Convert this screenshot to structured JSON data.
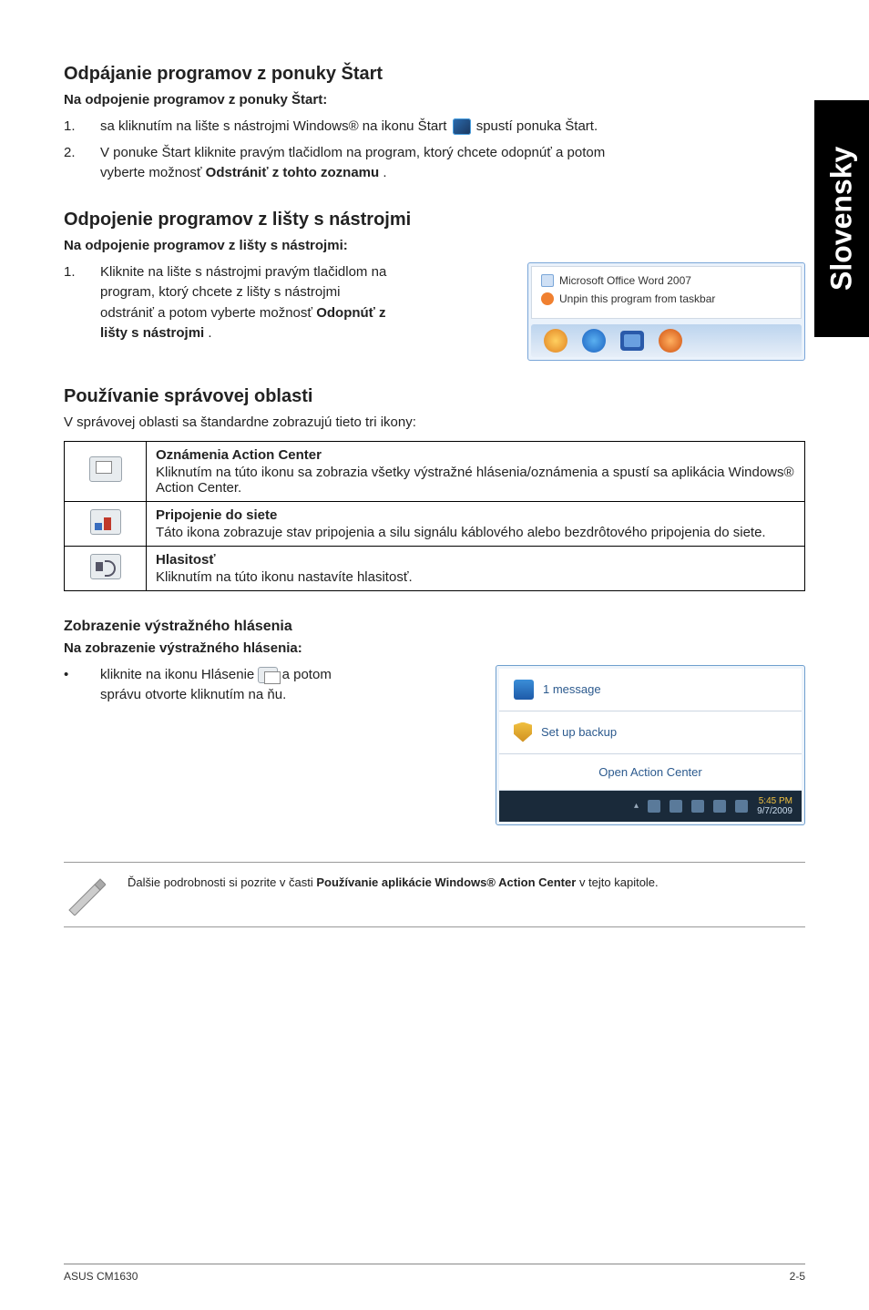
{
  "side_tab": "Slovensky",
  "sec1": {
    "title": "Odpájanie programov z ponuky Štart",
    "sub": "Na odpojenie programov z ponuky Štart:",
    "step1_a": "sa kliknutím na lište s nástrojmi Windows® na ikonu Štart ",
    "step1_b": " spustí ponuka Štart.",
    "step2": "V ponuke Štart kliknite pravým tlačidlom na program, ktorý chcete odopnúť a potom vyberte možnosť ",
    "step2_bold": "Odstrániť z tohto zoznamu",
    "step2_end": "."
  },
  "sec2": {
    "title": "Odpojenie programov z lišty s nástrojmi",
    "sub": "Na odpojenie programov z lišty s nástrojmi:",
    "step1": "Kliknite na lište s nástrojmi pravým tlačidlom na program, ktorý chcete z lišty s nástrojmi odstrániť a potom vyberte možnosť ",
    "step1_bold": "Odopnúť z lišty s nástrojmi",
    "step1_end": ".",
    "win": {
      "row1": "Microsoft Office Word 2007",
      "row2": "Unpin this program from taskbar"
    }
  },
  "sec3": {
    "title": "Používanie správovej oblasti",
    "intro": "V správovej oblasti sa štandardne zobrazujú tieto tri ikony:",
    "rows": [
      {
        "title": "Oznámenia Action Center",
        "desc": "Kliknutím na túto ikonu sa zobrazia všetky výstražné hlásenia/oznámenia a spustí sa aplikácia Windows® Action Center."
      },
      {
        "title": "Pripojenie do siete",
        "desc": "Táto ikona zobrazuje stav pripojenia a silu signálu káblového alebo bezdrôtového pripojenia do siete."
      },
      {
        "title": "Hlasitosť",
        "desc": "Kliknutím na túto ikonu nastavíte hlasitosť."
      }
    ]
  },
  "sec4": {
    "title": "Zobrazenie výstražného hlásenia",
    "sub": "Na zobrazenie výstražného hlásenia:",
    "bullet_a": "kliknite na ikonu Hlásenie ",
    "bullet_b": " a potom správu otvorte kliknutím na ňu.",
    "win": {
      "msg": "1 message",
      "backup": "Set up backup",
      "open": "Open Action Center",
      "time1": "5:45 PM",
      "time2": "9/7/2009"
    }
  },
  "note": {
    "a": "Ďalšie podrobnosti si pozrite v časti ",
    "b": "Používanie aplikácie Windows® Action Center",
    "c": " v tejto kapitole."
  },
  "footer": {
    "left": "ASUS CM1630",
    "right": "2-5"
  }
}
